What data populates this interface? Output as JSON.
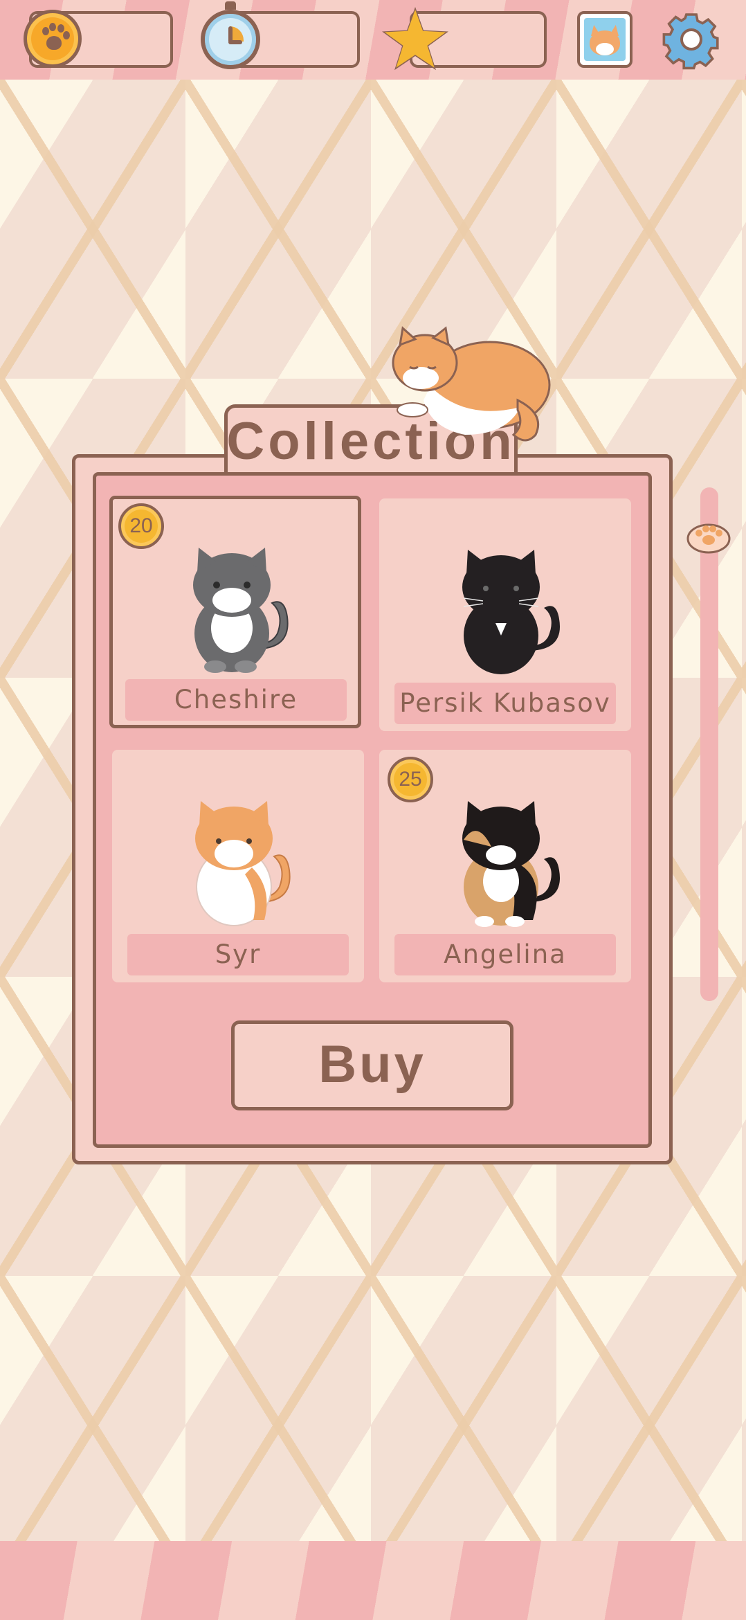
{
  "hud": {
    "coins_value": "",
    "timer_value": "",
    "stars_value": ""
  },
  "collection": {
    "title": "Collection",
    "cats": [
      {
        "name": "Cheshire",
        "price": "20",
        "selected": true,
        "coat": "gray"
      },
      {
        "name": "Persik Kubasov",
        "price": "",
        "selected": false,
        "coat": "black"
      },
      {
        "name": "Syr",
        "price": "",
        "selected": false,
        "coat": "ginger-white"
      },
      {
        "name": "Angelina",
        "price": "25",
        "selected": false,
        "coat": "calico"
      }
    ],
    "buy_label": "Buy"
  },
  "icons": {
    "coin": "paw-coin-icon",
    "timer": "stopwatch-icon",
    "star": "star-icon",
    "photo": "cat-photo-icon",
    "settings": "gear-icon",
    "scroll_thumb": "paw-icon"
  },
  "colors": {
    "outline": "#8b6252",
    "panel": "#f6d0c8",
    "panel_inner": "#f2b4b4",
    "coin": "#f5b731"
  }
}
